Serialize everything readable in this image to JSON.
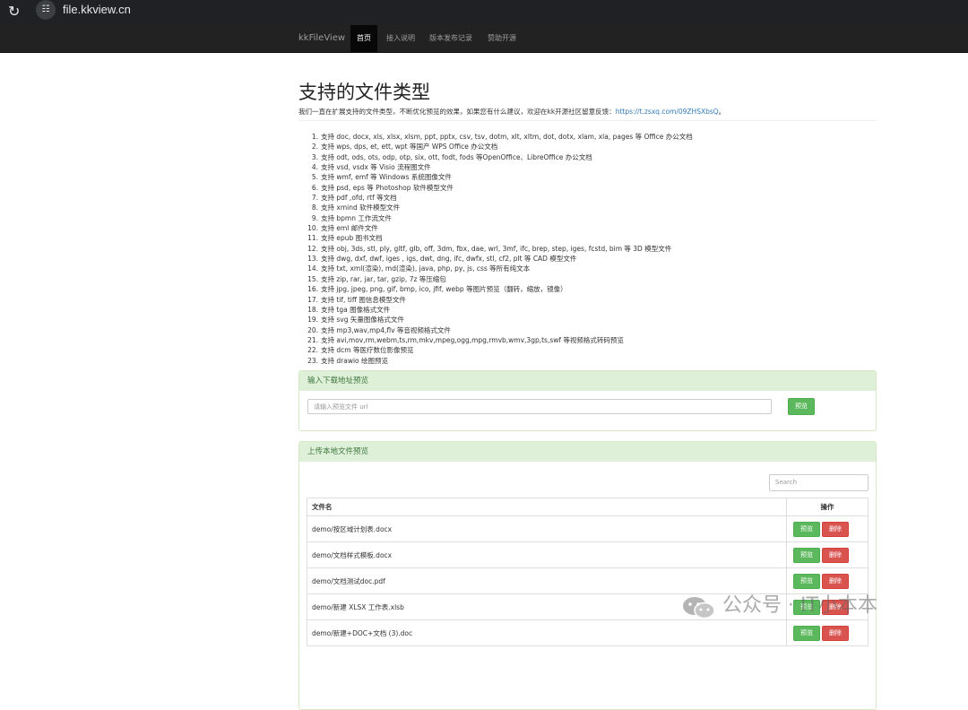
{
  "browser": {
    "url": "file.kkview.cn",
    "reload_icon": "reload-icon",
    "site_info_icon": "site-info-icon"
  },
  "navbar": {
    "brand": "kkFileView",
    "links": [
      "首页",
      "接入说明",
      "版本发布记录",
      "赞助开源"
    ],
    "active_index": 0
  },
  "page": {
    "title": "支持的文件类型",
    "intro_text": "我们一直在扩展支持的文件类型，不断优化预览的效果，如果您有什么建议，欢迎在kk开源社区留意反馈：",
    "intro_link": "https://t.zsxq.com/09ZHSXbsQ",
    "intro_end": "。"
  },
  "file_types": [
    "支持 doc, docx, xls, xlsx, xlsm, ppt, pptx, csv, tsv, dotm, xlt, xltm, dot, dotx, xlam, xla, pages 等 Office 办公文档",
    "支持 wps, dps, et, ett, wpt 等国产 WPS Office 办公文档",
    "支持 odt, ods, ots, odp, otp, six, ott, fodt, fods 等OpenOffice、LibreOffice 办公文档",
    "支持 vsd, vsdx 等 Visio 流程图文件",
    "支持 wmf, emf 等 Windows 系统图像文件",
    "支持 psd, eps 等 Photoshop 软件模型文件",
    "支持 pdf ,ofd, rtf 等文档",
    "支持 xmind 软件模型文件",
    "支持 bpmn 工作流文件",
    "支持 eml 邮件文件",
    "支持 epub 图书文档",
    "支持 obj, 3ds, stl, ply, gltf, glb, off, 3dm, fbx, dae, wrl, 3mf, ifc, brep, step, iges, fcstd, bim 等 3D 模型文件",
    "支持 dwg, dxf, dwf, iges , igs, dwt, dng, ifc, dwfx, stl, cf2, plt 等 CAD 模型文件",
    "支持 txt, xml(渲染), md(渲染), java, php, py, js, css 等所有纯文本",
    "支持 zip, rar, jar, tar, gzip, 7z 等压缩包",
    "支持 jpg, jpeg, png, gif, bmp, ico, jfif, webp 等图片预览（翻转，缩放，镜像）",
    "支持 tif, tiff 图信息模型文件",
    "支持 tga 图像格式文件",
    "支持 svg 矢量图像格式文件",
    "支持 mp3,wav,mp4,flv 等音视频格式文件",
    "支持 avi,mov,rm,webm,ts,rm,mkv,mpeg,ogg,mpg,rmvb,wmv,3gp,ts,swf 等视频格式转码预览",
    "支持 dcm 等医疗数位影像预览",
    "支持 drawio 绘图预览"
  ],
  "url_panel": {
    "heading": "输入下载地址预览",
    "input_placeholder": "请输入预览文件 url",
    "preview_button": "预览"
  },
  "upload_panel": {
    "heading": "上传本地文件预览",
    "search_placeholder": "Search",
    "columns": [
      "文件名",
      "操作"
    ],
    "rows": [
      "demo/按区域计划表.docx",
      "demo/文档样式模板.docx",
      "demo/文档测试doc.pdf",
      "demo/新建 XLSX 工作表.xlsb",
      "demo/新建+DOC+文档 (3).doc"
    ],
    "preview_label": "预览",
    "delete_label": "删除"
  },
  "watermark": {
    "icon": "wechat-icon",
    "text": "公众号 · IT小本本"
  }
}
